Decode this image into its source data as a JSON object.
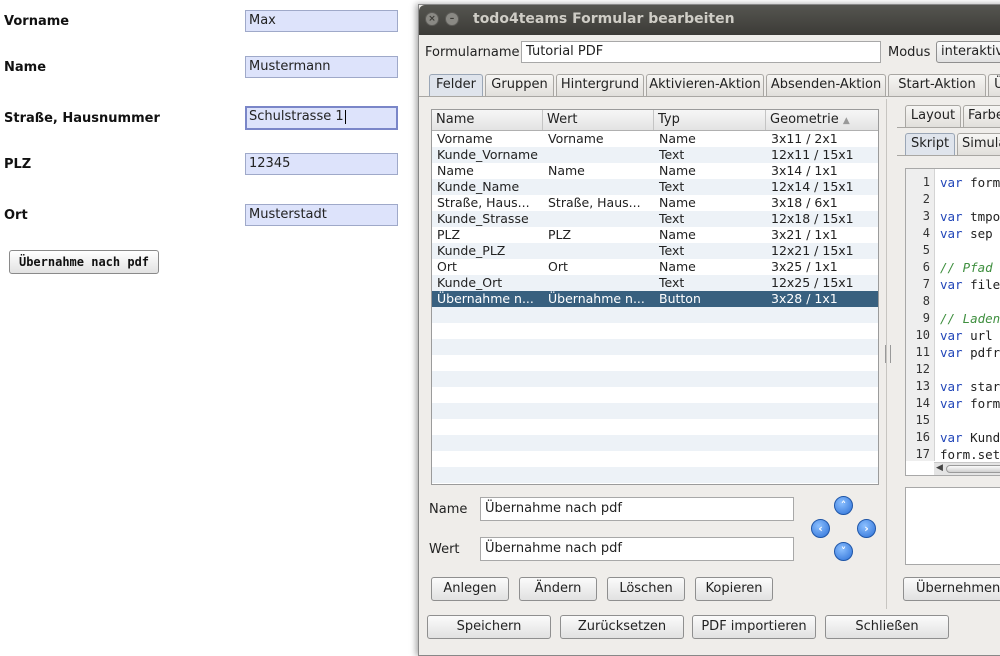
{
  "form": {
    "vorname_label": "Vorname",
    "vorname_value": "Max",
    "name_label": "Name",
    "name_value": "Mustermann",
    "strasse_label": "Straße, Hausnummer",
    "strasse_value": "Schulstrasse 1",
    "plz_label": "PLZ",
    "plz_value": "12345",
    "ort_label": "Ort",
    "ort_value": "Musterstadt",
    "pdf_button": "Übernahme nach pdf"
  },
  "dialog": {
    "title": "todo4teams Formular bearbeiten",
    "formname_label": "Formularname",
    "formname_value": "Tutorial PDF",
    "modus_label": "Modus",
    "modus_value": "interaktiv",
    "tabs": [
      "Felder",
      "Gruppen",
      "Hintergrund",
      "Aktivieren-Aktion",
      "Absenden-Aktion",
      "Start-Aktion",
      "Üb"
    ],
    "table": {
      "headers": [
        "Name",
        "Wert",
        "Typ",
        "Geometrie"
      ],
      "rows": [
        [
          "Vorname",
          "Vorname",
          "Name",
          "3x11 / 2x1"
        ],
        [
          "Kunde_Vorname",
          "",
          "Text",
          "12x11 / 15x1"
        ],
        [
          "Name",
          "Name",
          "Name",
          "3x14 / 1x1"
        ],
        [
          "Kunde_Name",
          "",
          "Text",
          "12x14 / 15x1"
        ],
        [
          "Straße, Haus...",
          "Straße, Haus...",
          "Name",
          "3x18 / 6x1"
        ],
        [
          "Kunde_Strasse",
          "",
          "Text",
          "12x18 / 15x1"
        ],
        [
          "PLZ",
          "PLZ",
          "Name",
          "3x21 / 1x1"
        ],
        [
          "Kunde_PLZ",
          "",
          "Text",
          "12x21 / 15x1"
        ],
        [
          "Ort",
          "Ort",
          "Name",
          "3x25 / 1x1"
        ],
        [
          "Kunde_Ort",
          "",
          "Text",
          "12x25 / 15x1"
        ],
        [
          "Übernahme n...",
          "Übernahme n...",
          "Button",
          "3x28 / 1x1"
        ]
      ],
      "selected_row": 10
    },
    "name_label": "Name",
    "name_value": "Übernahme nach pdf",
    "wert_label": "Wert",
    "wert_value": "Übernahme nach pdf",
    "buttons": {
      "anlegen": "Anlegen",
      "aendern": "Ändern",
      "loeschen": "Löschen",
      "kopieren": "Kopieren"
    },
    "bottom_buttons": {
      "speichern": "Speichern",
      "zuruecksetzen": "Zurücksetzen",
      "pdf_importieren": "PDF importieren",
      "schliessen": "Schließen"
    },
    "right_tabs_top": [
      "Layout",
      "Farbe"
    ],
    "right_tabs_bottom": [
      "Skript",
      "Simula"
    ],
    "code_lines": [
      {
        "n": "1",
        "text": "var form"
      },
      {
        "n": "2",
        "text": ""
      },
      {
        "n": "3",
        "text": "var tmpo"
      },
      {
        "n": "4",
        "text": "var sep"
      },
      {
        "n": "5",
        "text": ""
      },
      {
        "n": "6",
        "text": "// Pfad"
      },
      {
        "n": "7",
        "text": "var file"
      },
      {
        "n": "8",
        "text": ""
      },
      {
        "n": "9",
        "text": "// Laden"
      },
      {
        "n": "10",
        "text": "var url"
      },
      {
        "n": "11",
        "text": "var pdfr"
      },
      {
        "n": "12",
        "text": ""
      },
      {
        "n": "13",
        "text": "var star"
      },
      {
        "n": "14",
        "text": "var form"
      },
      {
        "n": "15",
        "text": ""
      },
      {
        "n": "16",
        "text": "var Kund"
      },
      {
        "n": "17",
        "text": "form.set"
      }
    ],
    "uebernehmen": "Übernehmen"
  }
}
